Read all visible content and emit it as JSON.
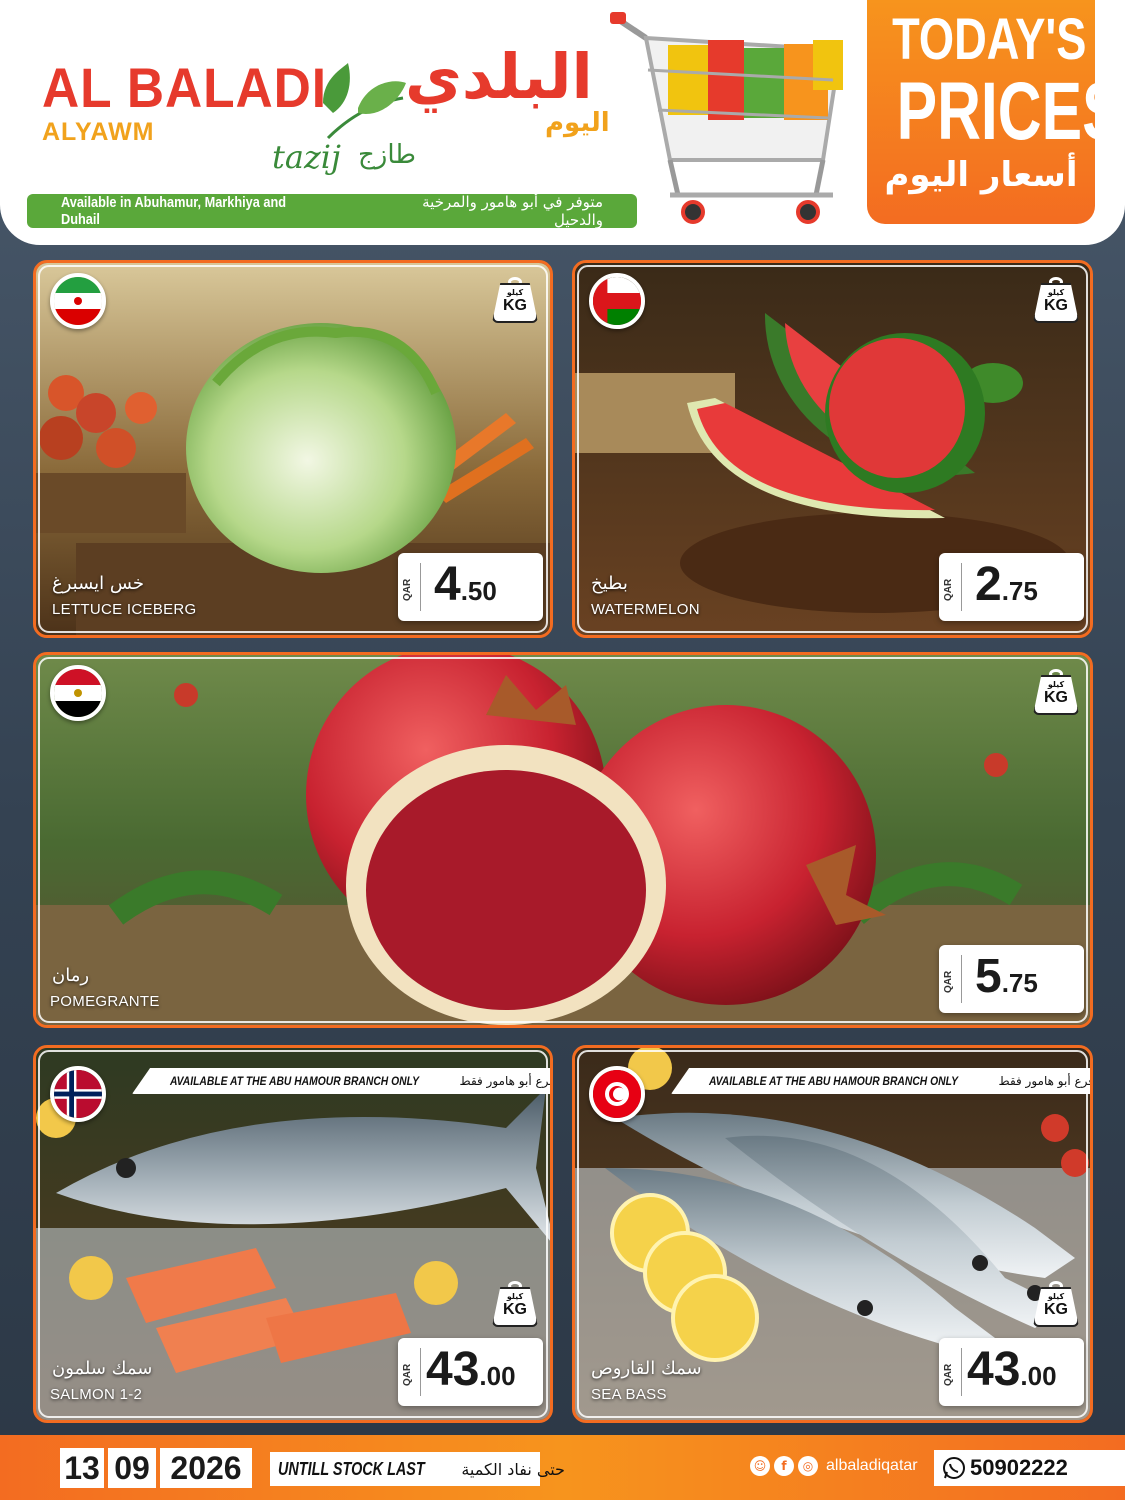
{
  "header": {
    "brand_en": "AL BALADI",
    "brand_en_sub": "ALYAWM",
    "brand_ar": "البلدي",
    "brand_ar_sub": "اليوم",
    "tagline_en": "tazij",
    "tagline_ar": "طازج",
    "availability_en": "Available in Abuhamur, Markhiya and Duhail",
    "availability_ar": "متوفر في أبو هامور والمرخية والدحيل",
    "today_line1": "TODAY'S",
    "today_line2": "PRICES",
    "today_ar": "أسعار اليوم"
  },
  "colors": {
    "brand_red": "#e63a2c",
    "brand_orange": "#f7941d",
    "brand_green": "#5aa83a"
  },
  "products": [
    {
      "name_ar": "خس ايسبرغ",
      "name_en": "LETTUCE ICEBERG",
      "currency": "QAR",
      "price_int": "4",
      "price_dec": ".50",
      "unit_ar": "كيلو",
      "unit_en": "KG",
      "flag": "iran-flag-icon"
    },
    {
      "name_ar": "بطيخ",
      "name_en": "WATERMELON",
      "currency": "QAR",
      "price_int": "2",
      "price_dec": ".75",
      "unit_ar": "كيلو",
      "unit_en": "KG",
      "flag": "oman-flag-icon"
    },
    {
      "name_ar": "رمان",
      "name_en": "POMEGRANTE",
      "currency": "QAR",
      "price_int": "5",
      "price_dec": ".75",
      "unit_ar": "كيلو",
      "unit_en": "KG",
      "flag": "egypt-flag-icon"
    },
    {
      "name_ar": "سمك سلمون",
      "name_en": "SALMON 1-2",
      "currency": "QAR",
      "price_int": "43",
      "price_dec": ".00",
      "unit_ar": "كيلو",
      "unit_en": "KG",
      "flag": "norway-flag-icon",
      "branch_en": "AVAILABLE AT THE ABU HAMOUR BRANCH ONLY",
      "branch_ar": "متوفر في فرع أبو هامور فقط"
    },
    {
      "name_ar": "سمك القاروص",
      "name_en": "SEA BASS",
      "currency": "QAR",
      "price_int": "43",
      "price_dec": ".00",
      "unit_ar": "كيلو",
      "unit_en": "KG",
      "flag": "tunisia-flag-icon",
      "branch_en": "AVAILABLE AT THE ABU HAMOUR BRANCH ONLY",
      "branch_ar": "متوفر في فرع أبو هامور فقط"
    }
  ],
  "footer": {
    "day": "13",
    "month": "09",
    "year": "2026",
    "stock_en": "UNTILL STOCK LAST",
    "stock_ar": "حتى نفاد الكمية",
    "social_handle": "albaladiqatar",
    "phone": "50902222"
  }
}
